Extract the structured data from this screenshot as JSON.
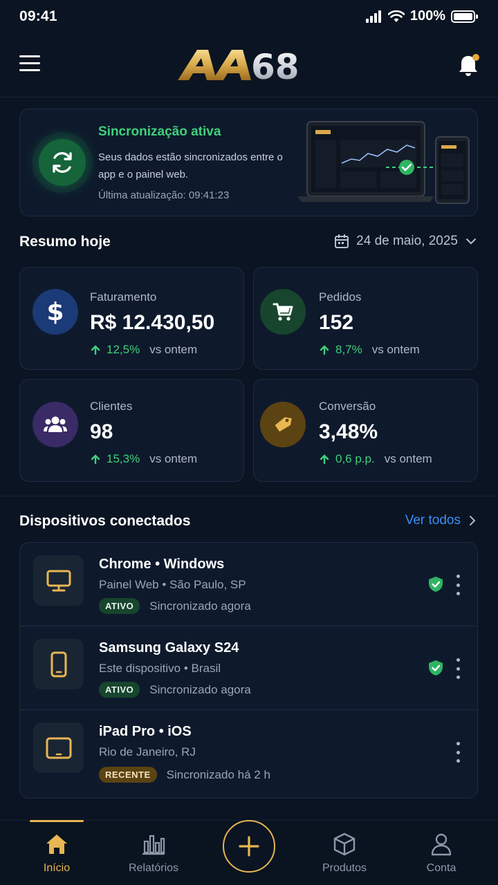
{
  "status_bar": {
    "time": "09:41",
    "battery": "100%"
  },
  "header": {
    "logo_text": "AA68",
    "menu_icon": "hamburger-menu-icon",
    "bell_icon": "bell-icon"
  },
  "sync": {
    "title": "Sincronização ativa",
    "description": "Seus dados estão sincronizados entre o app e o painel web.",
    "last_update": "Última atualização: 09:41:23",
    "color": "#3fd07a"
  },
  "summary": {
    "title": "Resumo hoje",
    "date": "24 de maio, 2025",
    "cards": [
      {
        "label": "Faturamento",
        "value": "R$ 12.430,50",
        "delta": "12,5%",
        "compare": "vs ontem",
        "icon": "dollar-icon",
        "color": "#1b3a78"
      },
      {
        "label": "Pedidos",
        "value": "152",
        "delta": "8,7%",
        "compare": "vs ontem",
        "icon": "cart-icon",
        "color": "#17452d"
      },
      {
        "label": "Clientes",
        "value": "98",
        "delta": "15,3%",
        "compare": "vs ontem",
        "icon": "users-icon",
        "color": "#3a2a66"
      },
      {
        "label": "Conversão",
        "value": "3,48%",
        "delta": "0,6 p.p.",
        "compare": "vs ontem",
        "icon": "tag-icon",
        "color": "#5c4312"
      }
    ]
  },
  "devices": {
    "title": "Dispositivos conectados",
    "see_all": "Ver todos",
    "items": [
      {
        "name": "Chrome • Windows",
        "sub": "Painel Web • São Paulo, SP",
        "badge": "ATIVO",
        "sync": "Sincronizado agora",
        "icon": "monitor-icon",
        "verified": true
      },
      {
        "name": "Samsung Galaxy S24",
        "sub": "Este dispositivo • Brasil",
        "badge": "ATIVO",
        "sync": "Sincronizado agora",
        "icon": "phone-icon",
        "verified": true
      },
      {
        "name": "iPad Pro • iOS",
        "sub": "Rio de Janeiro, RJ",
        "badge": "RECENTE",
        "sync": "Sincronizado há 2 h",
        "icon": "tablet-icon",
        "verified": false
      }
    ]
  },
  "nav": {
    "items": [
      {
        "label": "Início",
        "icon": "home-icon",
        "active": true
      },
      {
        "label": "Relatórios",
        "icon": "reports-icon",
        "active": false
      },
      {
        "label": "Produtos",
        "icon": "box-icon",
        "active": false
      },
      {
        "label": "Conta",
        "icon": "user-icon",
        "active": false
      }
    ],
    "fab_icon": "plus-icon",
    "accent": "#e8b652"
  }
}
